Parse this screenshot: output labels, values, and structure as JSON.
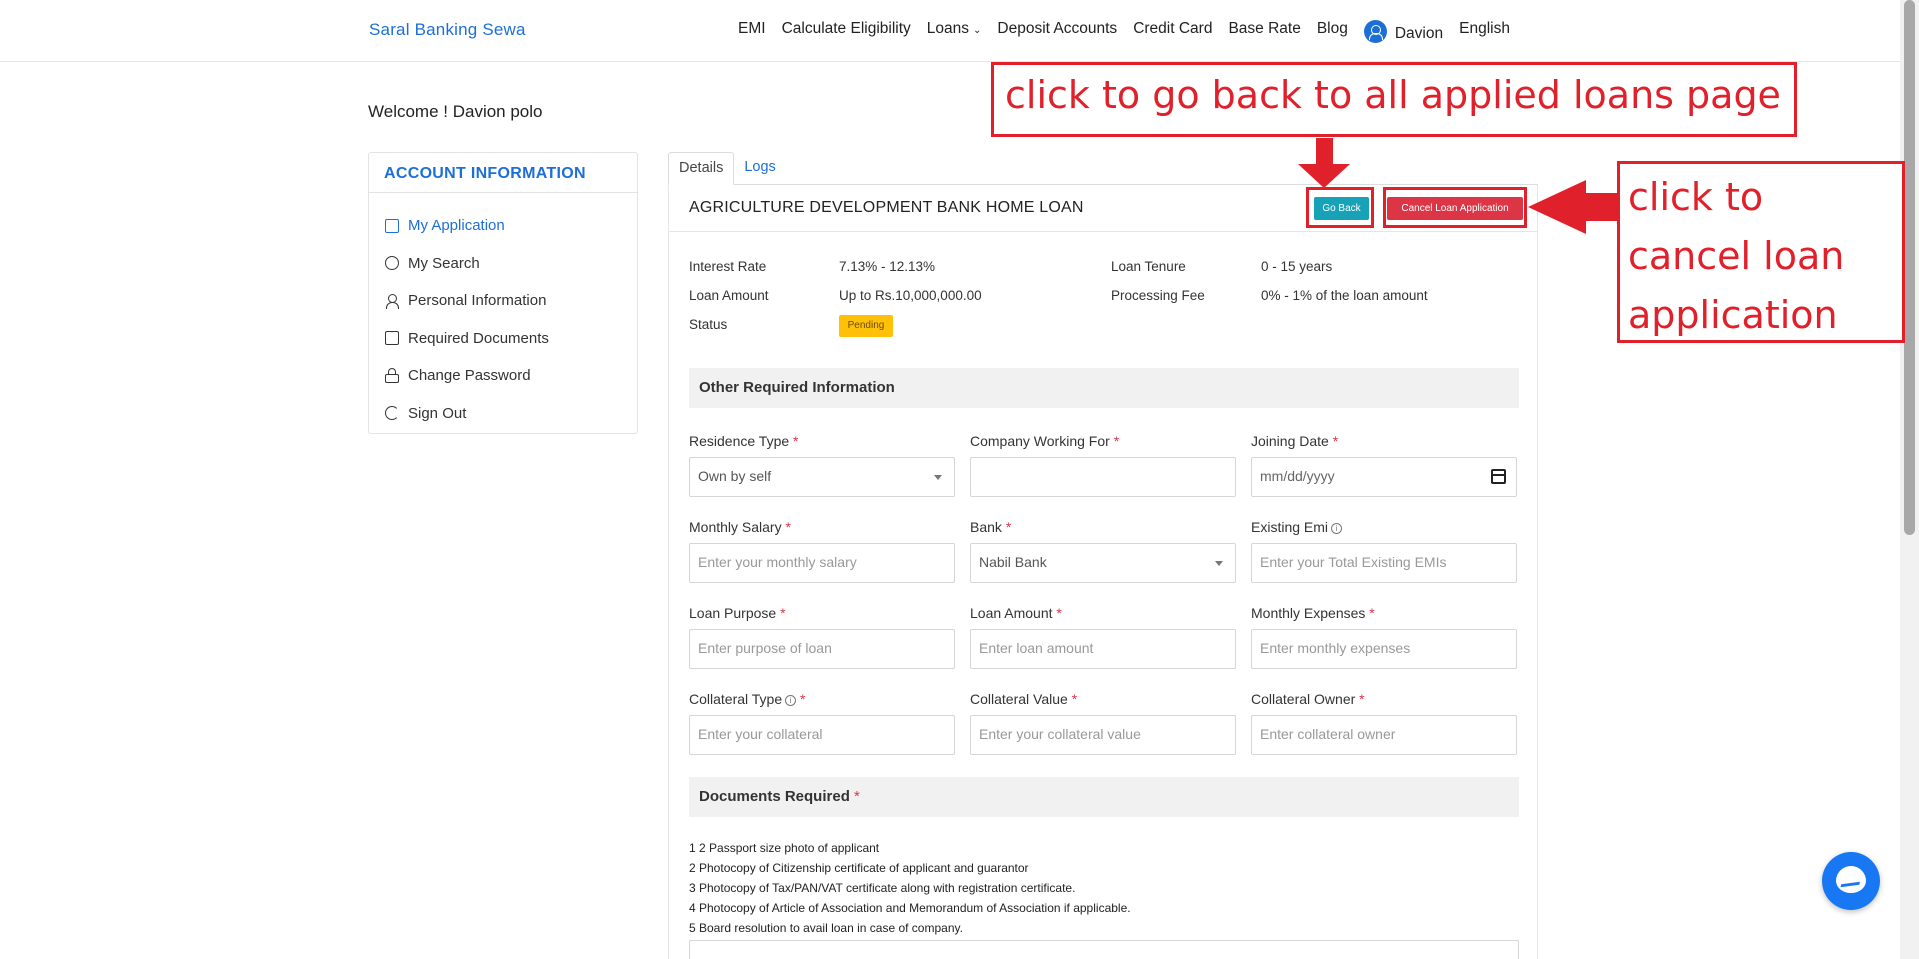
{
  "nav": {
    "brand": "Saral Banking Sewa",
    "items": [
      "EMI",
      "Calculate Eligibility",
      "Loans",
      "Deposit Accounts",
      "Credit Card",
      "Base Rate",
      "Blog"
    ],
    "user": "Davion",
    "language": "English"
  },
  "welcome": "Welcome ! Davion polo",
  "sidebar": {
    "heading": "ACCOUNT INFORMATION",
    "items": [
      {
        "label": "My Application",
        "icon": "application-icon",
        "active": true
      },
      {
        "label": "My Search",
        "icon": "globe-icon"
      },
      {
        "label": "Personal Information",
        "icon": "user-icon"
      },
      {
        "label": "Required Documents",
        "icon": "document-icon"
      },
      {
        "label": "Change Password",
        "icon": "lock-icon"
      },
      {
        "label": "Sign Out",
        "icon": "sign-out-icon"
      }
    ]
  },
  "tabs": [
    "Details",
    "Logs"
  ],
  "loan": {
    "title": "AGRICULTURE DEVELOPMENT BANK HOME LOAN",
    "go_back": "Go Back",
    "cancel": "Cancel Loan Application",
    "interest_rate_label": "Interest Rate",
    "interest_rate": "7.13% - 12.13%",
    "loan_amount_label": "Loan Amount",
    "loan_amount": "Up to Rs.10,000,000.00",
    "status_label": "Status",
    "status": "Pending",
    "tenure_label": "Loan Tenure",
    "tenure": "0 - 15 years",
    "fee_label": "Processing Fee",
    "fee": "0% - 1% of the loan amount"
  },
  "other_info": {
    "heading": "Other Required Information",
    "fields": {
      "residence_type": {
        "label": "Residence Type",
        "value": "Own by self"
      },
      "company": {
        "label": "Company Working For",
        "value": ""
      },
      "joining_date": {
        "label": "Joining Date",
        "placeholder": "mm/dd/yyyy"
      },
      "monthly_salary": {
        "label": "Monthly Salary",
        "placeholder": "Enter your monthly salary"
      },
      "bank": {
        "label": "Bank",
        "value": "Nabil Bank"
      },
      "existing_emi": {
        "label": "Existing Emi",
        "placeholder": "Enter your Total Existing EMIs"
      },
      "loan_purpose": {
        "label": "Loan Purpose",
        "placeholder": "Enter purpose of loan"
      },
      "loan_amount": {
        "label": "Loan Amount",
        "placeholder": "Enter loan amount"
      },
      "monthly_expenses": {
        "label": "Monthly Expenses",
        "placeholder": "Enter monthly expenses"
      },
      "collateral_type": {
        "label": "Collateral Type",
        "placeholder": "Enter your collateral"
      },
      "collateral_value": {
        "label": "Collateral Value",
        "placeholder": "Enter your collateral value"
      },
      "collateral_owner": {
        "label": "Collateral Owner",
        "placeholder": "Enter collateral owner"
      }
    }
  },
  "documents": {
    "heading": "Documents Required",
    "lines": [
      "1 2 Passport size photo of applicant",
      "2 Photocopy of Citizenship certificate of applicant and guarantor",
      "3 Photocopy of Tax/PAN/VAT certificate along with registration certificate.",
      "4 Photocopy of Article of Association and Memorandum of Association if applicable.",
      "5 Board resolution to avail loan in case of company."
    ]
  },
  "annotations": {
    "go_back_note": "click to go back to all applied loans page",
    "cancel_note": "click to cancel loan application"
  },
  "colors": {
    "brand": "#1d6fd8",
    "go_back": "#17a2b8",
    "cancel": "#dc3545",
    "pending": "#ffc107",
    "annotation": "#e0202a"
  }
}
